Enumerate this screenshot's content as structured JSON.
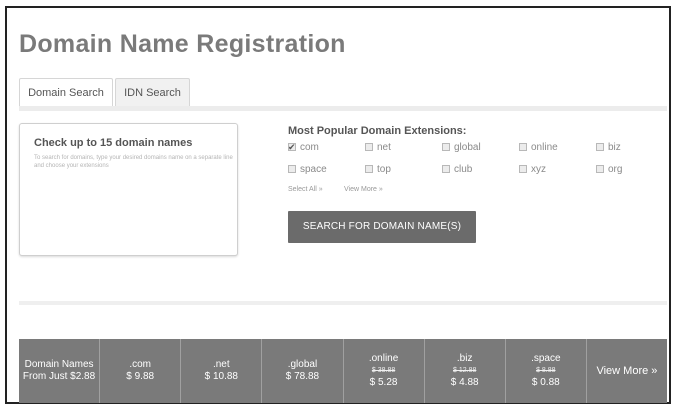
{
  "page_title": "Domain Name Registration",
  "tabs": [
    {
      "label": "Domain Search",
      "active": true
    },
    {
      "label": "IDN Search",
      "active": false
    }
  ],
  "search_box": {
    "title": "Check up to 15 domain names",
    "help": "To search for domains, type your desired domains name on a separate line and choose your extensions"
  },
  "extensions": {
    "title": "Most Popular Domain Extensions:",
    "items": [
      {
        "label": "com",
        "checked": true
      },
      {
        "label": "net",
        "checked": false
      },
      {
        "label": "global",
        "checked": false
      },
      {
        "label": "online",
        "checked": false
      },
      {
        "label": "biz",
        "checked": false
      },
      {
        "label": "space",
        "checked": false
      },
      {
        "label": "top",
        "checked": false
      },
      {
        "label": "club",
        "checked": false
      },
      {
        "label": "xyz",
        "checked": false
      },
      {
        "label": "org",
        "checked": false
      }
    ],
    "select_all": "Select All »",
    "view_more": "View More »"
  },
  "search_button": "SEARCH FOR DOMAIN NAME(S)",
  "pricing": {
    "intro_line1": "Domain Names",
    "intro_line2": "From Just $2.88",
    "cells": [
      {
        "name": ".com",
        "old": "",
        "price": "$ 9.88"
      },
      {
        "name": ".net",
        "old": "",
        "price": "$ 10.88"
      },
      {
        "name": ".global",
        "old": "",
        "price": "$ 78.88"
      },
      {
        "name": ".online",
        "old": "$ 38.88",
        "price": "$ 5.28"
      },
      {
        "name": ".biz",
        "old": "$ 12.88",
        "price": "$ 4.88"
      },
      {
        "name": ".space",
        "old": "$ 8.88",
        "price": "$ 0.88"
      }
    ],
    "view_more": "View More »"
  },
  "colors": {
    "title": "#7a7a7a",
    "button_bg": "#6b6b6b",
    "pricebar_bg": "#7a7a7a"
  }
}
